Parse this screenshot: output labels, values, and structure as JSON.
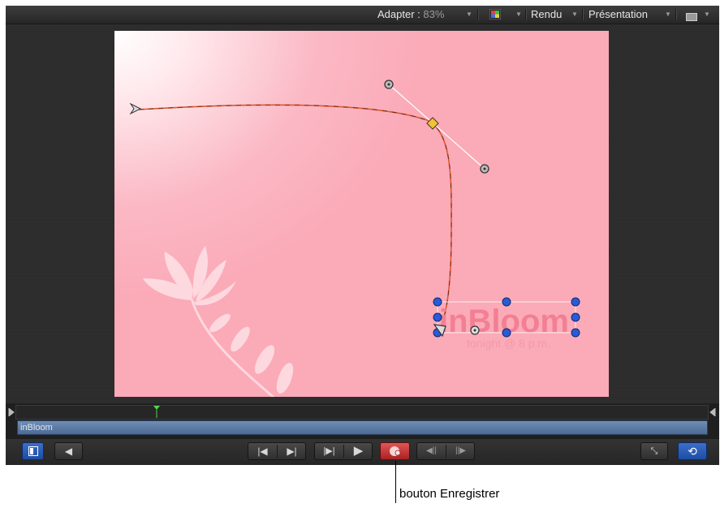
{
  "toolbar": {
    "fit_label": "Adapter :",
    "zoom_value": "83%",
    "render_label": "Rendu",
    "view_label": "Présentation"
  },
  "canvas": {
    "title_text": "inBloom",
    "subtitle_text": "tonight @ 8 p.m.",
    "background_color": "#fbaab8",
    "path_color": "#e4572e",
    "handle_color": "#2a5bd7"
  },
  "timeline": {
    "track_label": "inBloom"
  },
  "transport": {
    "record_button_state": "active",
    "accent_color": "#2a5bd7",
    "record_color": "#d63b3b"
  },
  "annotation": {
    "callout_label": "bouton Enregistrer"
  }
}
